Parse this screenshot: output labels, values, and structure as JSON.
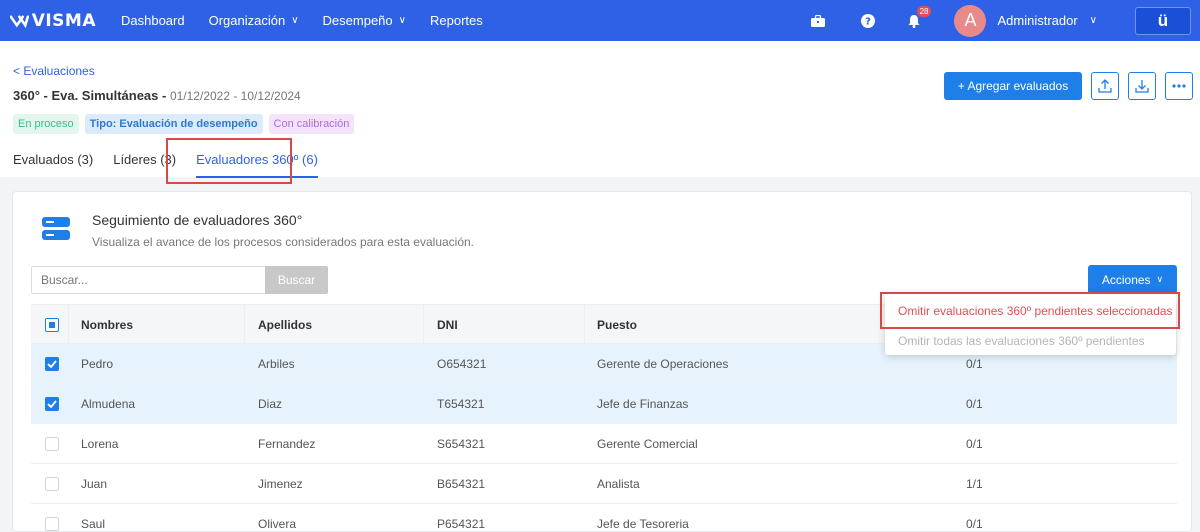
{
  "nav": {
    "brand": "VISMA",
    "items": [
      {
        "label": "Dashboard",
        "dropdown": false
      },
      {
        "label": "Organización",
        "dropdown": true
      },
      {
        "label": "Desempeño",
        "dropdown": true
      },
      {
        "label": "Reportes",
        "dropdown": false
      }
    ],
    "notifications_count": "28",
    "avatar_initial": "A",
    "user_name": "Administrador",
    "app_switch_label": "ü"
  },
  "header": {
    "back_label": "< Evaluaciones",
    "title": "360° - Eva. Simultáneas -",
    "dates": "01/12/2022 - 10/12/2024",
    "tags": [
      "En proceso",
      "Tipo: Evaluación de desempeño",
      "Con calibración"
    ],
    "tabs": [
      "Evaluados (3)",
      "Líderes (3)",
      "Evaluadores 360º (6)"
    ],
    "add_button": "+ Agregar evaluados"
  },
  "card": {
    "title": "Seguimiento de evaluadores 360°",
    "subtitle": "Visualiza el avance de los procesos considerados para esta evaluación.",
    "search_placeholder": "Buscar...",
    "search_button": "Buscar",
    "actions_button": "Acciones"
  },
  "table": {
    "headers": [
      "Nombres",
      "Apellidos",
      "DNI",
      "Puesto"
    ],
    "rows": [
      {
        "nombre": "Pedro",
        "apellido": "Arbiles",
        "dni": "O654321",
        "puesto": "Gerente de Operaciones",
        "progreso": "0/1",
        "selected": true
      },
      {
        "nombre": "Almudena",
        "apellido": "Diaz",
        "dni": "T654321",
        "puesto": "Jefe de Finanzas",
        "progreso": "0/1",
        "selected": true
      },
      {
        "nombre": "Lorena",
        "apellido": "Fernandez",
        "dni": "S654321",
        "puesto": "Gerente Comercial",
        "progreso": "0/1",
        "selected": false
      },
      {
        "nombre": "Juan",
        "apellido": "Jimenez",
        "dni": "B654321",
        "puesto": "Analista",
        "progreso": "1/1",
        "selected": false
      },
      {
        "nombre": "Saul",
        "apellido": "Olivera",
        "dni": "P654321",
        "puesto": "Jefe de Tesoreria",
        "progreso": "0/1",
        "selected": false
      }
    ]
  },
  "dropdown": {
    "items": [
      "Omitir evaluaciones 360º pendientes seleccionadas",
      "Omitir todas las evaluaciones 360º pendientes"
    ]
  },
  "colors": {
    "topbar": "#2e61e6",
    "primary": "#1e7fe8",
    "highlight": "#d94848",
    "selected_row": "#e7f3fc"
  }
}
